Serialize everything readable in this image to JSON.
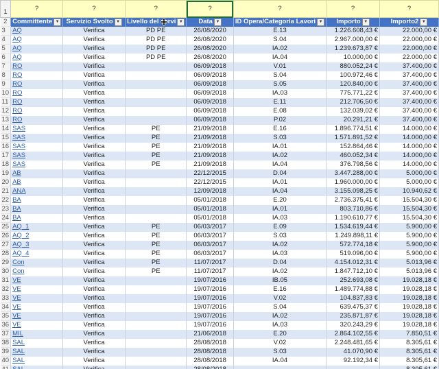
{
  "filter_row_marker": "?",
  "column_headers": [
    "Committente",
    "Servizio Svolto",
    "Livello del servizio",
    "Data",
    "ID Opera/Categoria Lavori",
    "Importo",
    "Importo2"
  ],
  "column_header_display": [
    "Committente",
    "Servizio Svolto",
    "Livello del servi",
    "Data",
    "ID Opera/Categoria Lavori",
    "Importo",
    "Importo2"
  ],
  "row_numbers": [
    "1",
    "2",
    "3",
    "4",
    "5",
    "6",
    "7",
    "8",
    "9",
    "10",
    "11",
    "12",
    "13",
    "14",
    "15",
    "16",
    "17",
    "18",
    "19",
    "20",
    "21",
    "22",
    "23",
    "24",
    "25",
    "26",
    "27",
    "28",
    "29",
    "30",
    "31",
    "32",
    "33",
    "34",
    "35",
    "36",
    "37",
    "38",
    "39",
    "40",
    "41"
  ],
  "rows": [
    [
      "AQ",
      "Verifica",
      "PD PE",
      "26/08/2020",
      "E.13",
      "1.226.608,43 €",
      "22.000,00 €"
    ],
    [
      "AQ",
      "Verifica",
      "PD PE",
      "26/08/2020",
      "S.04",
      "2.967.000,00 €",
      "22.000,00 €"
    ],
    [
      "AQ",
      "Verifica",
      "PD PE",
      "26/08/2020",
      "IA.02",
      "1.239.673,87 €",
      "22.000,00 €"
    ],
    [
      "AQ",
      "Verifica",
      "PD PE",
      "26/08/2020",
      "IA.04",
      "10.000,00 €",
      "22.000,00 €"
    ],
    [
      "RO",
      "Verifica",
      "",
      "06/09/2018",
      "V.01",
      "880.052,24 €",
      "37.400,00 €"
    ],
    [
      "RO",
      "Verifica",
      "",
      "06/09/2018",
      "S.04",
      "100.972,46 €",
      "37.400,00 €"
    ],
    [
      "RO",
      "Verifica",
      "",
      "06/09/2018",
      "S.05",
      "120.840,00 €",
      "37.400,00 €"
    ],
    [
      "RO",
      "Verifica",
      "",
      "06/09/2018",
      "IA.03",
      "775.771,22 €",
      "37.400,00 €"
    ],
    [
      "RO",
      "Verifica",
      "",
      "06/09/2018",
      "E.11",
      "212.706,50 €",
      "37.400,00 €"
    ],
    [
      "RO",
      "Verifica",
      "",
      "06/09/2018",
      "E.08",
      "132.039,02 €",
      "37.400,00 €"
    ],
    [
      "RO",
      "Verifica",
      "",
      "06/09/2018",
      "P.02",
      "20.291,21 €",
      "37.400,00 €"
    ],
    [
      "SAS",
      "Verifica",
      "PE",
      "21/09/2018",
      "E.16",
      "1.896.774,51 €",
      "14.000,00 €"
    ],
    [
      "SAS",
      "Verifica",
      "PE",
      "21/09/2018",
      "S.03",
      "1.571.891,52 €",
      "14.000,00 €"
    ],
    [
      "SAS",
      "Verifica",
      "PE",
      "21/09/2018",
      "IA.01",
      "152.864,46 €",
      "14.000,00 €"
    ],
    [
      "SAS",
      "Verifica",
      "PE",
      "21/09/2018",
      "IA.02",
      "460.052,34 €",
      "14.000,00 €"
    ],
    [
      "SAS",
      "Verifica",
      "PE",
      "21/09/2018",
      "IA.04",
      "376.798,56 €",
      "14.000,00 €"
    ],
    [
      "AB",
      "Verifica",
      "",
      "22/12/2015",
      "D.04",
      "3.447.288,00 €",
      "5.000,00 €"
    ],
    [
      "AB",
      "Verifica",
      "",
      "22/12/2015",
      "IA.01",
      "1.960.000,00 €",
      "5.000,00 €"
    ],
    [
      "ANA",
      "Verifica",
      "",
      "12/09/2018",
      "IA.04",
      "3.155.098,25 €",
      "10.940,62 €"
    ],
    [
      "BA",
      "Verifica",
      "",
      "05/01/2018",
      "E.20",
      "2.736.375,41 €",
      "15.504,30 €"
    ],
    [
      "BA",
      "Verifica",
      "",
      "05/01/2018",
      "IA.01",
      "803.710,86 €",
      "15.504,30 €"
    ],
    [
      "BA",
      "Verifica",
      "",
      "05/01/2018",
      "IA.03",
      "1.190.610,77 €",
      "15.504,30 €"
    ],
    [
      "AQ_1",
      "Verifica",
      "PE",
      "06/03/2017",
      "E.09",
      "1.534.619,44 €",
      "5.900,00 €"
    ],
    [
      "AQ_2",
      "Verifica",
      "PE",
      "06/03/2017",
      "S.03",
      "1.249.898,11 €",
      "5.900,00 €"
    ],
    [
      "AQ_3",
      "Verifica",
      "PE",
      "06/03/2017",
      "IA.02",
      "572.774,18 €",
      "5.900,00 €"
    ],
    [
      "AQ_4",
      "Verifica",
      "PE",
      "06/03/2017",
      "IA.03",
      "519.096,00 €",
      "5.900,00 €"
    ],
    [
      "Con",
      "Verifica",
      "PE",
      "11/07/2017",
      "D.04",
      "4.154.012,31 €",
      "5.013,96 €"
    ],
    [
      "Con",
      "Verifica",
      "PE",
      "11/07/2017",
      "IA.02",
      "1.847.712,10 €",
      "5.013,96 €"
    ],
    [
      "VE",
      "Verifica",
      "",
      "19/07/2016",
      "IB.05",
      "252.693,08 €",
      "19.028,18 €"
    ],
    [
      "VE",
      "Verifica",
      "",
      "19/07/2016",
      "E.16",
      "1.489.774,88 €",
      "19.028,18 €"
    ],
    [
      "VE",
      "Verifica",
      "",
      "19/07/2016",
      "V.02",
      "104.837,83 €",
      "19.028,18 €"
    ],
    [
      "VE",
      "Verifica",
      "",
      "19/07/2016",
      "S.04",
      "639.475,37 €",
      "19.028,18 €"
    ],
    [
      "VE",
      "Verifica",
      "",
      "19/07/2016",
      "IA.02",
      "235.871,87 €",
      "19.028,18 €"
    ],
    [
      "VE",
      "Verifica",
      "",
      "19/07/2016",
      "IA.03",
      "320.243,29 €",
      "19.028,18 €"
    ],
    [
      "MIL",
      "Verifica",
      "",
      "21/06/2018",
      "E.20",
      "2.864.102,55 €",
      "7.850,51 €"
    ],
    [
      "SAL",
      "Verifica",
      "",
      "28/08/2018",
      "V.02",
      "2.248.481,65 €",
      "8.305,61 €"
    ],
    [
      "SAL",
      "Verifica",
      "",
      "28/08/2018",
      "S.03",
      "41.070,90 €",
      "8.305,61 €"
    ],
    [
      "SAL",
      "Verifica",
      "",
      "28/08/2018",
      "IA.04",
      "92.192,34 €",
      "8.305,61 €"
    ],
    [
      "SAL",
      "Verifica",
      "",
      "28/08/2018",
      "",
      "",
      "8.305,61 €"
    ]
  ],
  "colors": {
    "header_blue": "#4472c4",
    "band_blue": "#dce6f4",
    "filter_yellow": "#ffffc4",
    "link": "#2f5ea8"
  },
  "icons": {
    "filter_dropdown": "dropdown-arrow-icon",
    "cursor": "move-cursor-icon"
  }
}
